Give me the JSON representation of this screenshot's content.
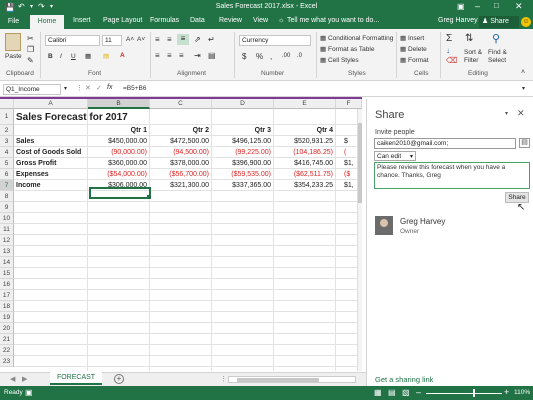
{
  "titlebar": {
    "title": "Sales Forecast 2017.xlsx - Excel",
    "user": "Greg Harvey",
    "share_label": "Share"
  },
  "tabs": [
    "File",
    "Home",
    "Insert",
    "Page Layout",
    "Formulas",
    "Data",
    "Review",
    "View"
  ],
  "tell_me": "Tell me what you want to do...",
  "ribbon": {
    "clipboard": {
      "paste": "Paste",
      "label": "Clipboard"
    },
    "font": {
      "name": "Calibri",
      "size": "11",
      "label": "Font"
    },
    "alignment": {
      "label": "Alignment"
    },
    "number": {
      "format": "Currency",
      "label": "Number"
    },
    "styles": {
      "cond": "Conditional Formatting",
      "table": "Format as Table",
      "cell": "Cell Styles",
      "label": "Styles"
    },
    "cells": {
      "insert": "Insert",
      "delete": "Delete",
      "format": "Format",
      "label": "Cells"
    },
    "editing": {
      "sort": "Sort &",
      "filter": "Filter",
      "find": "Find &",
      "select": "Select",
      "label": "Editing"
    }
  },
  "formula_bar": {
    "name_box": "Q1_Income",
    "fx": "fx",
    "formula": "=B5+B6"
  },
  "columns": [
    "A",
    "B",
    "C",
    "D",
    "E",
    "F"
  ],
  "rows": [
    "1",
    "2",
    "3",
    "4",
    "5",
    "6",
    "7",
    "8",
    "9",
    "10",
    "11",
    "12",
    "13",
    "14",
    "15",
    "16",
    "17",
    "18",
    "19",
    "20",
    "21",
    "22",
    "23"
  ],
  "sheet": {
    "title": "Sales Forecast for 2017",
    "headers": [
      "Qtr 1",
      "Qtr 2",
      "Qtr 3",
      "Qtr 4"
    ],
    "data": [
      {
        "label": "Sales",
        "values": [
          "$450,000.00",
          "$472,500.00",
          "$496,125.00",
          "$520,931.25"
        ],
        "overflow": "$"
      },
      {
        "label": "Cost of Goods Sold",
        "values": [
          "(90,000.00)",
          "(94,500.00)",
          "(99,225.00)",
          "(104,186.25)"
        ],
        "overflow": "("
      },
      {
        "label": "Gross Profit",
        "values": [
          "$360,000.00",
          "$378,000.00",
          "$396,900.00",
          "$416,745.00"
        ],
        "overflow": "$1,"
      },
      {
        "label": "Expenses",
        "values": [
          "($54,000.00)",
          "($56,700.00)",
          "($59,535.00)",
          "($62,511.75)"
        ],
        "overflow": "($"
      },
      {
        "label": "Income",
        "values": [
          "$306,000.00",
          "$321,300.00",
          "$337,365.00",
          "$354,233.25"
        ],
        "overflow": "$1,"
      }
    ]
  },
  "sheet_tab": "FORECAST",
  "status": {
    "ready": "Ready",
    "zoom": "110%"
  },
  "share_pane": {
    "title": "Share",
    "invite_label": "Invite people",
    "email": "caiken2010@gmail.com;",
    "permission": "Can edit",
    "message": "Please review this forecast when you have a chance. Thanks, Greg",
    "share_button": "Share",
    "owner_name": "Greg Harvey",
    "owner_role": "Owner",
    "link": "Get a sharing link"
  },
  "colors": {
    "excel_green": "#217346",
    "negative": "#dd2222"
  }
}
